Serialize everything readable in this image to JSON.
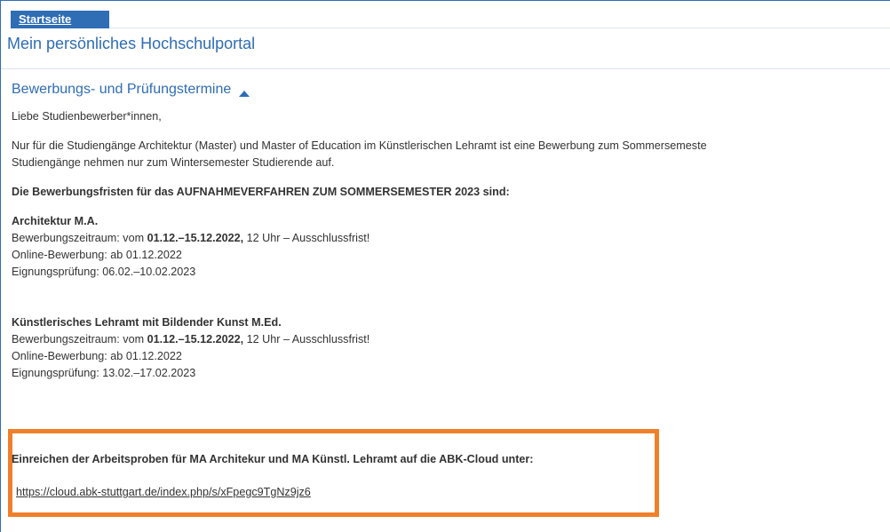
{
  "breadcrumb": {
    "label": "Startseite"
  },
  "page_title": "Mein persönliches Hochschulportal",
  "section": {
    "title": "Bewerbungs- und Prüfungstermine",
    "collapse_icon": "chevron-up-icon"
  },
  "content": {
    "greeting": "Liebe Studienbewerber*innen,",
    "intro_line1": "Nur für die Studiengänge Architektur (Master) und Master of Education im Künstlerischen Lehramt ist eine Bewerbung zum Sommersemeste",
    "intro_line2": "Studiengänge nehmen nur zum Wintersemester Studierende auf.",
    "deadlines_heading": "Die Bewerbungsfristen für das AUFNAHMEVERFAHREN ZUM SOMMERSEMESTER 2023 sind:",
    "programs": [
      {
        "name": "Architektur M.A.",
        "period_prefix": "Bewerbungszeitraum: vom ",
        "period_dates": "01.12.–15.12.2022,",
        "period_suffix": " 12 Uhr – Ausschlussfrist!",
        "online": "Online-Bewerbung: ab 01.12.2022",
        "exam": "Eignungsprüfung: 06.02.–10.02.2023"
      },
      {
        "name": "Künstlerisches Lehramt mit Bildender Kunst M.Ed.",
        "period_prefix": "Bewerbungszeitraum: vom ",
        "period_dates": "01.12.–15.12.2022,",
        "period_suffix": " 12 Uhr – Ausschlussfrist!",
        "online": "Online-Bewerbung: ab 01.12.2022",
        "exam": "Eignungsprüfung: 13.02.–17.02.2023"
      }
    ]
  },
  "highlight": {
    "title": "Einreichen der Arbeitsproben für MA Architekur und MA Künstl. Lehramt auf die ABK-Cloud unter:",
    "link": "https://cloud.abk-stuttgart.de/index.php/s/xFpegc9TgNz9jz6",
    "border_color": "#f07f2b"
  },
  "colors": {
    "accent": "#2f6db5",
    "text": "#333333"
  }
}
